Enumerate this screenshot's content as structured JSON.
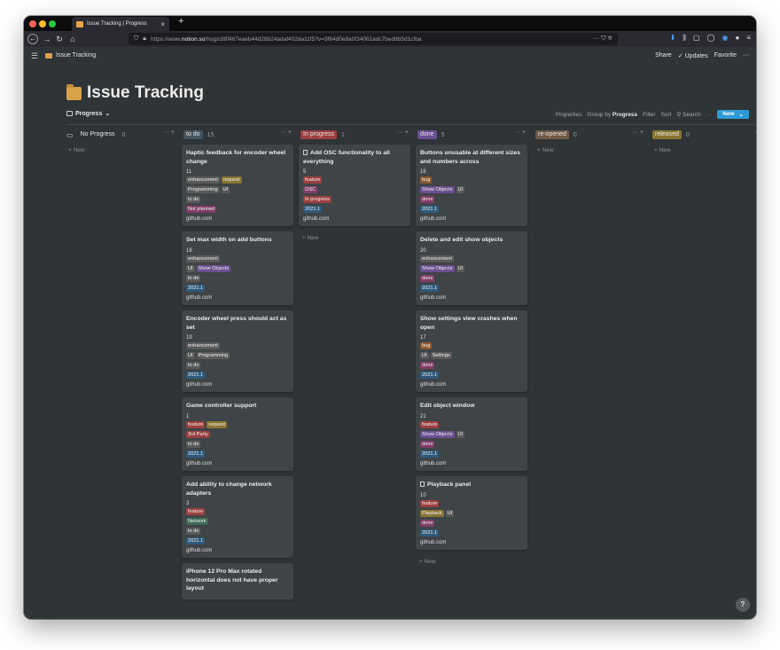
{
  "browser": {
    "tab_title": "Issue Tracking | Progress",
    "url_prefix": "https://www.",
    "url_domain": "notion.so",
    "url_rest": "/hog/c88f467eaeb44d28b24adaf402da11f5?v=9f64d0e8a0f34061adc7bed8b5d1cfba",
    "url_right_icons": "··· ⛉ ☆"
  },
  "notion": {
    "breadcrumb": "Issue Tracking",
    "share": "Share",
    "updates": "Updates",
    "favorite": "Favorite",
    "more": "···"
  },
  "page": {
    "title": "Issue Tracking",
    "view_name": "Progress",
    "properties": "Properties",
    "group_by_label": "Group by",
    "group_by_value": "Progress",
    "filter": "Filter",
    "sort": "Sort",
    "search": "Search",
    "more": "···",
    "new_label": "New",
    "new_caret": "⌄"
  },
  "colors": {
    "gray": "#5a5a5a",
    "brown": "#6f5a48",
    "orange": "#8f5a2e",
    "yellow": "#8a7632",
    "green": "#3e6b55",
    "blue": "#2f5a7c",
    "purple": "#6a4f8f",
    "pink": "#823d67",
    "red": "#9c3f3f"
  },
  "board": {
    "columns": [
      {
        "name": "No Progress",
        "count": "0",
        "color": "",
        "new_label": "+ New",
        "cards": []
      },
      {
        "name": "to do",
        "count": "15",
        "color": "#44545f",
        "new_label": "",
        "cards": [
          {
            "title": "Haptic feedback for encoder wheel change",
            "number": "11",
            "tag_rows": [
              [
                [
                  "enhancement",
                  "gray"
                ],
                [
                  "request",
                  "yellow"
                ]
              ],
              [
                [
                  "Programming",
                  "gray"
                ],
                [
                  "UI",
                  "gray"
                ]
              ],
              [
                [
                  "to do",
                  "gray"
                ]
              ],
              [
                [
                  "Not planned",
                  "pink"
                ]
              ]
            ],
            "source": "github.com"
          },
          {
            "title": "Set max width on add buttons",
            "number": "18",
            "tag_rows": [
              [
                [
                  "enhancement",
                  "gray"
                ]
              ],
              [
                [
                  "UI",
                  "gray"
                ],
                [
                  "Show Objects",
                  "purple"
                ]
              ],
              [
                [
                  "to do",
                  "gray"
                ]
              ],
              [
                [
                  "2021.1",
                  "blue"
                ]
              ]
            ],
            "source": "github.com"
          },
          {
            "title": "Encoder wheel press should act as set",
            "number": "19",
            "tag_rows": [
              [
                [
                  "enhancement",
                  "gray"
                ]
              ],
              [
                [
                  "UI",
                  "gray"
                ],
                [
                  "Programming",
                  "gray"
                ]
              ],
              [
                [
                  "to do",
                  "gray"
                ]
              ],
              [
                [
                  "2021.1",
                  "blue"
                ]
              ]
            ],
            "source": "github.com"
          },
          {
            "title": "Game controller support",
            "number": "1",
            "tag_rows": [
              [
                [
                  "feature",
                  "red"
                ],
                [
                  "request",
                  "yellow"
                ]
              ],
              [
                [
                  "3rd Party",
                  "red"
                ]
              ],
              [
                [
                  "to do",
                  "gray"
                ]
              ],
              [
                [
                  "2021.1",
                  "blue"
                ]
              ]
            ],
            "source": "github.com"
          },
          {
            "title": "Add ability to change network adapters",
            "number": "3",
            "tag_rows": [
              [
                [
                  "feature",
                  "red"
                ]
              ],
              [
                [
                  "Network",
                  "green"
                ]
              ],
              [
                [
                  "to do",
                  "gray"
                ]
              ],
              [
                [
                  "2021.1",
                  "blue"
                ]
              ]
            ],
            "source": "github.com"
          },
          {
            "title": "iPhone 12 Pro Max rotated horizontal does not have proper layout",
            "number": "",
            "tag_rows": [],
            "source": ""
          }
        ]
      },
      {
        "name": "In progress",
        "count": "1",
        "color": "#9c3f3f",
        "new_label": "+ New",
        "cards": [
          {
            "title": "Add OSC functionality to all everything",
            "number": "5",
            "doc": true,
            "tag_rows": [
              [
                [
                  "feature",
                  "red"
                ]
              ],
              [
                [
                  "OSC",
                  "pink"
                ]
              ],
              [
                [
                  "In progress",
                  "red"
                ]
              ],
              [
                [
                  "2021.1",
                  "blue"
                ]
              ]
            ],
            "source": "github.com"
          }
        ]
      },
      {
        "name": "done",
        "count": "5",
        "color": "#6a4f8f",
        "new_label": "+ New",
        "cards": [
          {
            "title": "Buttons unusable at different sizes and numbers across",
            "number": "16",
            "tag_rows": [
              [
                [
                  "bug",
                  "orange"
                ]
              ],
              [
                [
                  "Show Objects",
                  "purple"
                ],
                [
                  "UI",
                  "gray"
                ]
              ],
              [
                [
                  "done",
                  "pink"
                ]
              ],
              [
                [
                  "2021.1",
                  "blue"
                ]
              ]
            ],
            "source": "github.com"
          },
          {
            "title": "Delete and edit show objects",
            "number": "20",
            "tag_rows": [
              [
                [
                  "enhancement",
                  "gray"
                ]
              ],
              [
                [
                  "Show Objects",
                  "purple"
                ],
                [
                  "UI",
                  "gray"
                ]
              ],
              [
                [
                  "done",
                  "pink"
                ]
              ],
              [
                [
                  "2021.1",
                  "blue"
                ]
              ]
            ],
            "source": "github.com"
          },
          {
            "title": "Show settings view crashes when open",
            "number": "17",
            "tag_rows": [
              [
                [
                  "bug",
                  "orange"
                ]
              ],
              [
                [
                  "UI",
                  "gray"
                ],
                [
                  "Settings",
                  "gray"
                ]
              ],
              [
                [
                  "done",
                  "pink"
                ]
              ],
              [
                [
                  "2021.1",
                  "blue"
                ]
              ]
            ],
            "source": "github.com"
          },
          {
            "title": "Edit object window",
            "number": "21",
            "tag_rows": [
              [
                [
                  "feature",
                  "red"
                ]
              ],
              [
                [
                  "Show Objects",
                  "purple"
                ],
                [
                  "UI",
                  "gray"
                ]
              ],
              [
                [
                  "done",
                  "pink"
                ]
              ],
              [
                [
                  "2021.1",
                  "blue"
                ]
              ]
            ],
            "source": "github.com"
          },
          {
            "title": "Playback panel",
            "number": "10",
            "doc": true,
            "tag_rows": [
              [
                [
                  "feature",
                  "red"
                ]
              ],
              [
                [
                  "Playback",
                  "yellow"
                ],
                [
                  "UI",
                  "gray"
                ]
              ],
              [
                [
                  "done",
                  "pink"
                ]
              ],
              [
                [
                  "2021.1",
                  "blue"
                ]
              ]
            ],
            "source": "github.com"
          }
        ]
      },
      {
        "name": "re-opened",
        "count": "0",
        "color": "#6f5a48",
        "new_label": "+ New",
        "cards": []
      },
      {
        "name": "released",
        "count": "0",
        "color": "#8a7632",
        "new_label": "+ New",
        "cards": []
      }
    ]
  },
  "help": "?"
}
